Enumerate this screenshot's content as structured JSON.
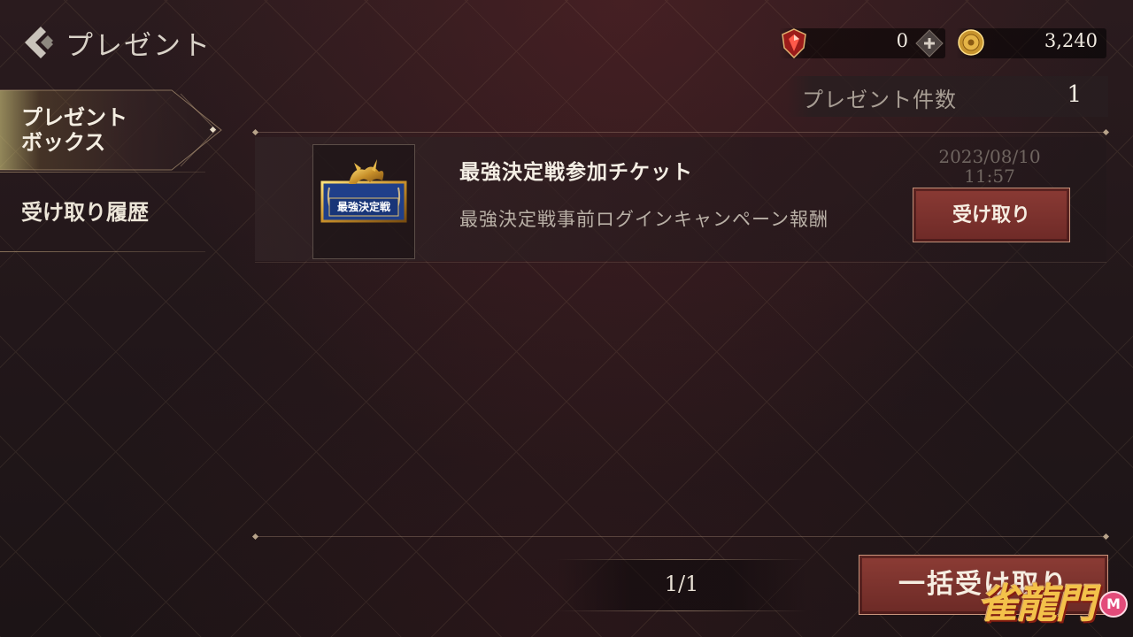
{
  "header": {
    "title": "プレゼント"
  },
  "currency": {
    "gem": {
      "value": "0",
      "icon": "red-gem-shield-icon"
    },
    "add_icon": "plus-icon",
    "coin": {
      "value": "3,240",
      "icon": "gold-coin-icon"
    }
  },
  "sidebar": {
    "items": [
      {
        "label_line1": "プレゼント",
        "label_line2": "ボックス",
        "active": true
      },
      {
        "label": "受け取り履歴",
        "active": false
      }
    ]
  },
  "summary": {
    "count_label": "プレゼント件数",
    "count_value": "1"
  },
  "presents": [
    {
      "icon_text": "最強決定戦",
      "name": "最強決定戦参加チケット",
      "description": "最強決定戦事前ログインキャンペーン報酬",
      "date": "2023/08/10",
      "time": "11:57",
      "receive_label": "受け取り"
    }
  ],
  "pager": {
    "text": "1/1"
  },
  "bulk_receive_label": "一括受け取り",
  "logo_text": "雀龍門",
  "logo_badge": "M",
  "colors": {
    "accent_red": "#7a302c",
    "gold": "#f3c14a",
    "bg": "#22171a"
  }
}
